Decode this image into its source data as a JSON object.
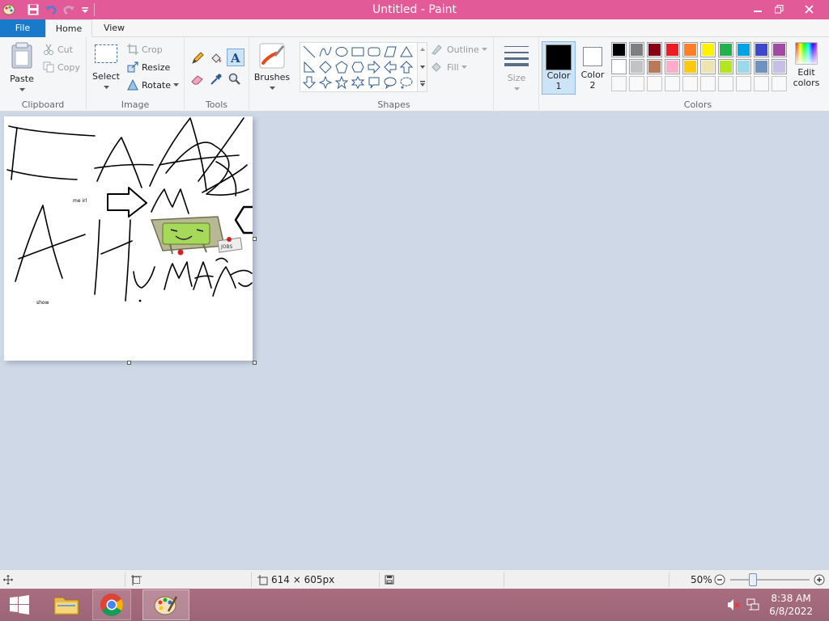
{
  "titlebar": {
    "title": "Untitled - Paint",
    "accent": "#e25a97"
  },
  "tabs": {
    "file": "File",
    "home": "Home",
    "view": "View"
  },
  "clipboard": {
    "paste": "Paste",
    "cut": "Cut",
    "copy": "Copy",
    "label": "Clipboard"
  },
  "image": {
    "select": "Select",
    "crop": "Crop",
    "resize": "Resize",
    "rotate": "Rotate",
    "label": "Image"
  },
  "tools": {
    "label": "Tools"
  },
  "brushes": {
    "label": "Brushes"
  },
  "shapes": {
    "label": "Shapes",
    "outline": "Outline",
    "fill": "Fill"
  },
  "size": {
    "label": "Size"
  },
  "color1": {
    "line1": "Color",
    "line2": "1"
  },
  "color2": {
    "line1": "Color",
    "line2": "2"
  },
  "colors": {
    "label": "Colors",
    "edit1": "Edit",
    "edit2": "colors",
    "row1": [
      "#000000",
      "#7f7f7f",
      "#880015",
      "#ed1c24",
      "#ff7f27",
      "#fff200",
      "#22b14c",
      "#00a2e8",
      "#3f48cc",
      "#a349a4"
    ],
    "row2": [
      "#ffffff",
      "#c3c3c3",
      "#b97a57",
      "#ffaec9",
      "#ffc90e",
      "#efe4b0",
      "#b5e61d",
      "#99d9ea",
      "#7092be",
      "#c8bfe7"
    ]
  },
  "canvas": {
    "text_me_irl": "me irl",
    "text_show": "show",
    "sticker": "JOBS"
  },
  "status": {
    "dimensions": "614 × 605px",
    "zoom": "50%"
  },
  "taskbar": {
    "time": "8:38 AM",
    "date": "6/8/2022"
  }
}
